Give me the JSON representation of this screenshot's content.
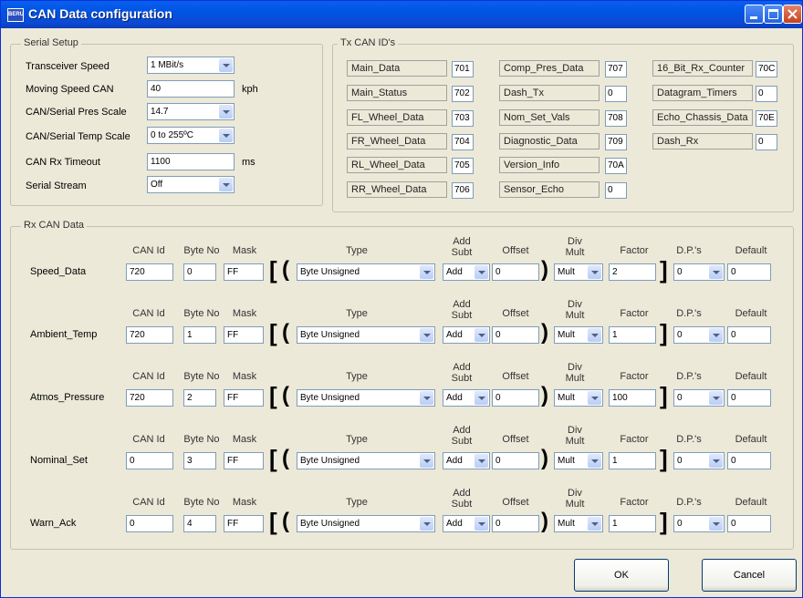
{
  "window": {
    "title": "CAN Data configuration",
    "app_icon_text": "BERU"
  },
  "serial_setup": {
    "group_label": "Serial Setup",
    "transceiver_speed": {
      "label": "Transceiver Speed",
      "value": "1 MBit/s"
    },
    "moving_speed": {
      "label": "Moving Speed CAN",
      "value": "40",
      "unit": "kph"
    },
    "pres_scale": {
      "label": "CAN/Serial Pres Scale",
      "value": "14.7"
    },
    "temp_scale": {
      "label": "CAN/Serial Temp Scale",
      "value": "0 to 255ºC"
    },
    "rx_timeout": {
      "label": "CAN Rx Timeout",
      "value": "1100",
      "unit": "ms"
    },
    "serial_stream": {
      "label": "Serial Stream",
      "value": "Off"
    }
  },
  "tx_ids": {
    "group_label": "Tx CAN ID's",
    "col1": [
      {
        "name": "Main_Data",
        "value": "701"
      },
      {
        "name": "Main_Status",
        "value": "702"
      },
      {
        "name": "FL_Wheel_Data",
        "value": "703"
      },
      {
        "name": "FR_Wheel_Data",
        "value": "704"
      },
      {
        "name": "RL_Wheel_Data",
        "value": "705"
      },
      {
        "name": "RR_Wheel_Data",
        "value": "706"
      }
    ],
    "col2": [
      {
        "name": "Comp_Pres_Data",
        "value": "707"
      },
      {
        "name": "Dash_Tx",
        "value": "0"
      },
      {
        "name": "Nom_Set_Vals",
        "value": "708"
      },
      {
        "name": "Diagnostic_Data",
        "value": "709"
      },
      {
        "name": "Version_Info",
        "value": "70A"
      },
      {
        "name": "Sensor_Echo",
        "value": "0"
      }
    ],
    "col3": [
      {
        "name": "16_Bit_Rx_Counter",
        "value": "70C"
      },
      {
        "name": "Datagram_Timers",
        "value": "0"
      },
      {
        "name": "Echo_Chassis_Data",
        "value": "70E"
      },
      {
        "name": "Dash_Rx",
        "value": "0"
      }
    ]
  },
  "rx": {
    "group_label": "Rx CAN Data",
    "headers": {
      "can_id": "CAN Id",
      "byte_no": "Byte No",
      "mask": "Mask",
      "type": "Type",
      "add_sub_1": "Add",
      "add_sub_2": "Subt",
      "offset": "Offset",
      "div_mult_1": "Div",
      "div_mult_2": "Mult",
      "factor": "Factor",
      "dps": "D.P.'s",
      "default": "Default"
    },
    "rows": [
      {
        "name": "Speed_Data",
        "can_id": "720",
        "byte_no": "0",
        "mask": "FF",
        "type": "Byte Unsigned",
        "add_sub": "Add",
        "offset": "0",
        "div_mult": "Mult",
        "factor": "2",
        "dps": "0",
        "default": "0"
      },
      {
        "name": "Ambient_Temp",
        "can_id": "720",
        "byte_no": "1",
        "mask": "FF",
        "type": "Byte Unsigned",
        "add_sub": "Add",
        "offset": "0",
        "div_mult": "Mult",
        "factor": "1",
        "dps": "0",
        "default": "0"
      },
      {
        "name": "Atmos_Pressure",
        "can_id": "720",
        "byte_no": "2",
        "mask": "FF",
        "type": "Byte Unsigned",
        "add_sub": "Add",
        "offset": "0",
        "div_mult": "Mult",
        "factor": "100",
        "dps": "0",
        "default": "0"
      },
      {
        "name": "Nominal_Set",
        "can_id": "0",
        "byte_no": "3",
        "mask": "FF",
        "type": "Byte Unsigned",
        "add_sub": "Add",
        "offset": "0",
        "div_mult": "Mult",
        "factor": "1",
        "dps": "0",
        "default": "0"
      },
      {
        "name": "Warn_Ack",
        "can_id": "0",
        "byte_no": "4",
        "mask": "FF",
        "type": "Byte Unsigned",
        "add_sub": "Add",
        "offset": "0",
        "div_mult": "Mult",
        "factor": "1",
        "dps": "0",
        "default": "0"
      }
    ]
  },
  "buttons": {
    "ok": "OK",
    "cancel": "Cancel"
  },
  "icons": {
    "app": "beru-app-icon",
    "minimize": "minimize-icon",
    "maximize": "maximize-icon",
    "close": "close-icon"
  },
  "colors": {
    "titlebar": "#0054E3",
    "dialog_bg": "#ECE9D8",
    "close_button": "#C6401D"
  }
}
